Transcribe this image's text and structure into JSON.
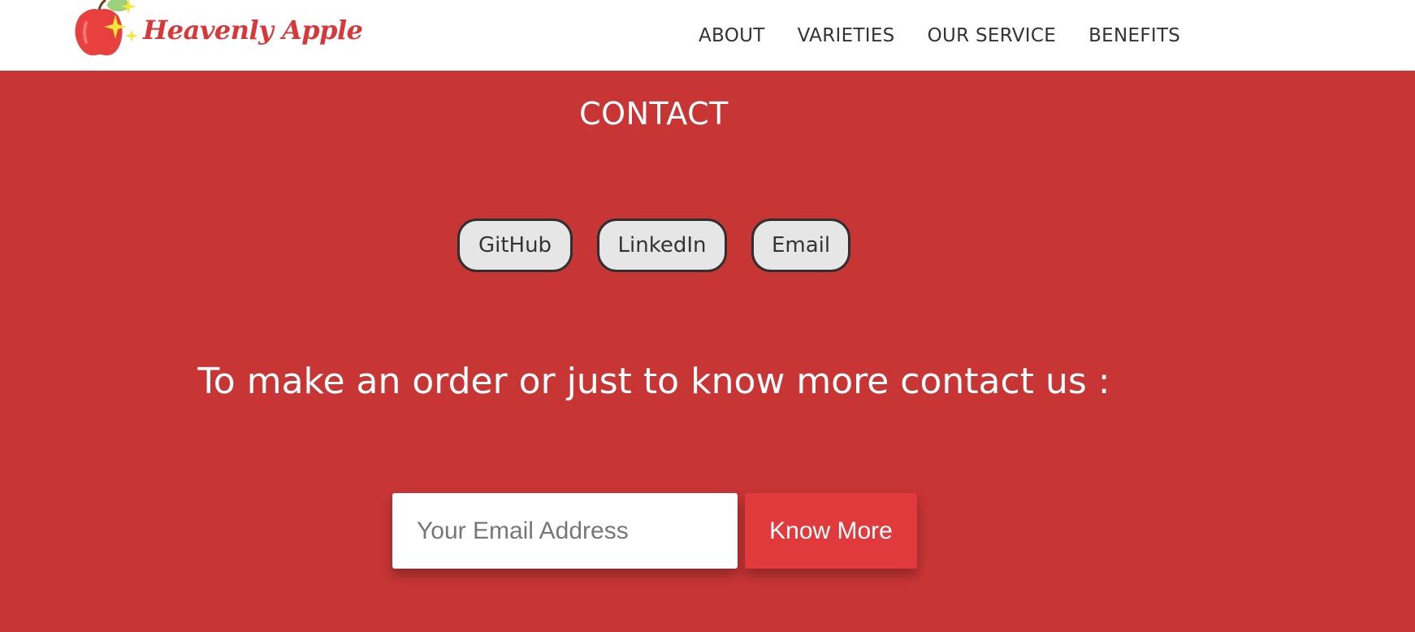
{
  "header": {
    "brand": "Heavenly Apple",
    "logo_icon": "apple-icon",
    "colors": {
      "background": "#ffffff",
      "brand": "#d9383b",
      "apple": "#e8403f",
      "sparkle": "#f5e63a",
      "leaf": "#9bd17a"
    }
  },
  "nav": {
    "items": [
      "ABOUT",
      "VARIETIES",
      "OUR SERVICE",
      "BENEFITS"
    ]
  },
  "contact": {
    "title": "CONTACT",
    "links": [
      "GitHub",
      "LinkedIn",
      "Email"
    ],
    "cta": "To make an order or just to know more contact us :",
    "colors": {
      "background": "#c73535",
      "pill": "#e6e6e6",
      "button": "#e03a3c"
    }
  },
  "form": {
    "email_placeholder": "Your Email Address",
    "email_value": "",
    "button_label": "Know More"
  }
}
